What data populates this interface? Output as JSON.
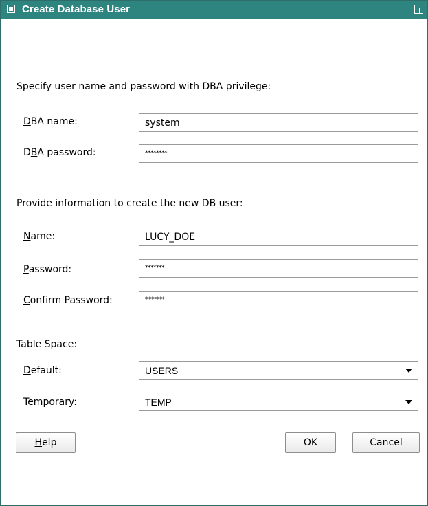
{
  "window": {
    "title": "Create Database User"
  },
  "dba_section": {
    "heading": "Specify user name and password with DBA privilege:",
    "name_label_pre": "",
    "name_label_u": "D",
    "name_label_post": "BA name:",
    "name_value": "system",
    "password_label_pre": "D",
    "password_label_u": "B",
    "password_label_post": "A password:",
    "password_value": "********"
  },
  "user_section": {
    "heading": "Provide information to create the new DB user:",
    "name_label_u": "N",
    "name_label_post": "ame:",
    "name_value": "LUCY_DOE",
    "password_label_u": "P",
    "password_label_post": "assword:",
    "password_value": "*******",
    "confirm_label_u": "C",
    "confirm_label_post": "onfirm Password:",
    "confirm_value": "*******"
  },
  "tablespace": {
    "heading": "Table Space:",
    "default_label_u": "D",
    "default_label_post": "efault:",
    "default_value": "USERS",
    "temporary_label_u": "T",
    "temporary_label_post": "emporary:",
    "temporary_value": "TEMP"
  },
  "buttons": {
    "help_u": "H",
    "help_post": "elp",
    "ok": "OK",
    "cancel": "Cancel"
  },
  "colors": {
    "titlebar": "#2e8580",
    "title_text": "#ffffff"
  }
}
